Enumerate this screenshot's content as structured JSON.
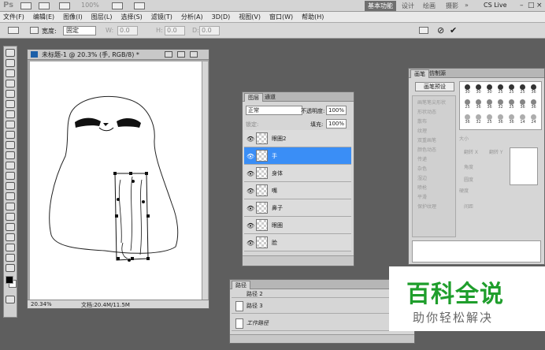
{
  "appbar": {
    "logo": "Ps",
    "zoom": "100%",
    "workspace_active": "基本功能",
    "workspaces": [
      "设计",
      "绘画",
      "摄影"
    ],
    "more": "»",
    "cs_live": "CS Live"
  },
  "menu": [
    "文件(F)",
    "编辑(E)",
    "图像(I)",
    "图层(L)",
    "选择(S)",
    "滤镜(T)",
    "分析(A)",
    "3D(D)",
    "视图(V)",
    "窗口(W)",
    "帮助(H)"
  ],
  "options": {
    "mode_label": "宽度:",
    "mode_value": "固定",
    "w_label": "W:",
    "w_value": "0.0",
    "h_label": "H:",
    "h_value": "0.0",
    "d_label": "D:",
    "d_value": "0.0"
  },
  "document": {
    "title": "未标题-1 @ 20.3% (手, RGB/8) *",
    "zoom": "20.34%",
    "doc_info": "文档:20.4M/11.5M"
  },
  "layers": {
    "tabs": [
      "图层",
      "通道"
    ],
    "blend_mode": "正常",
    "opacity_label": "不透明度:",
    "opacity_value": "100%",
    "lock_label": "锁定:",
    "fill_label": "填充:",
    "fill_value": "100%",
    "items": [
      {
        "name": "眼圈2",
        "selected": false
      },
      {
        "name": "手",
        "selected": true
      },
      {
        "name": "身体",
        "selected": false
      },
      {
        "name": "嘴",
        "selected": false
      },
      {
        "name": "鼻子",
        "selected": false
      },
      {
        "name": "眼圈",
        "selected": false
      },
      {
        "name": "脸",
        "selected": false
      }
    ]
  },
  "brush": {
    "tabs": [
      "画笔",
      "仿制源"
    ],
    "preset_button": "画笔预设",
    "options": [
      "画笔笔尖形状",
      "形状动态",
      "散布",
      "纹理",
      "双重画笔",
      "颜色动态",
      "传递",
      "杂色",
      "湿边",
      "喷枪",
      "平滑",
      "保护纹理"
    ],
    "sizes": [
      "30",
      "30",
      "30",
      "25",
      "25",
      "25",
      "36",
      "25",
      "36",
      "36",
      "32",
      "25",
      "36",
      "36",
      "36",
      "32",
      "25",
      "36",
      "36",
      "14",
      "24"
    ],
    "size_label": "大小",
    "flip_x": "翻转 X",
    "flip_y": "翻转 Y",
    "angle_label": "角度",
    "roundness_label": "圆度",
    "hardness_label": "硬度",
    "spacing_label": "间距"
  },
  "paths": {
    "tab": "路径",
    "items": [
      "路径 2",
      "路径 3",
      "工作路径"
    ]
  },
  "watermark": {
    "main": "百科全说",
    "sub": "助你轻松解决"
  },
  "colors": {
    "selection": "#3a8ef6",
    "watermark_green": "#1f9e2c"
  }
}
